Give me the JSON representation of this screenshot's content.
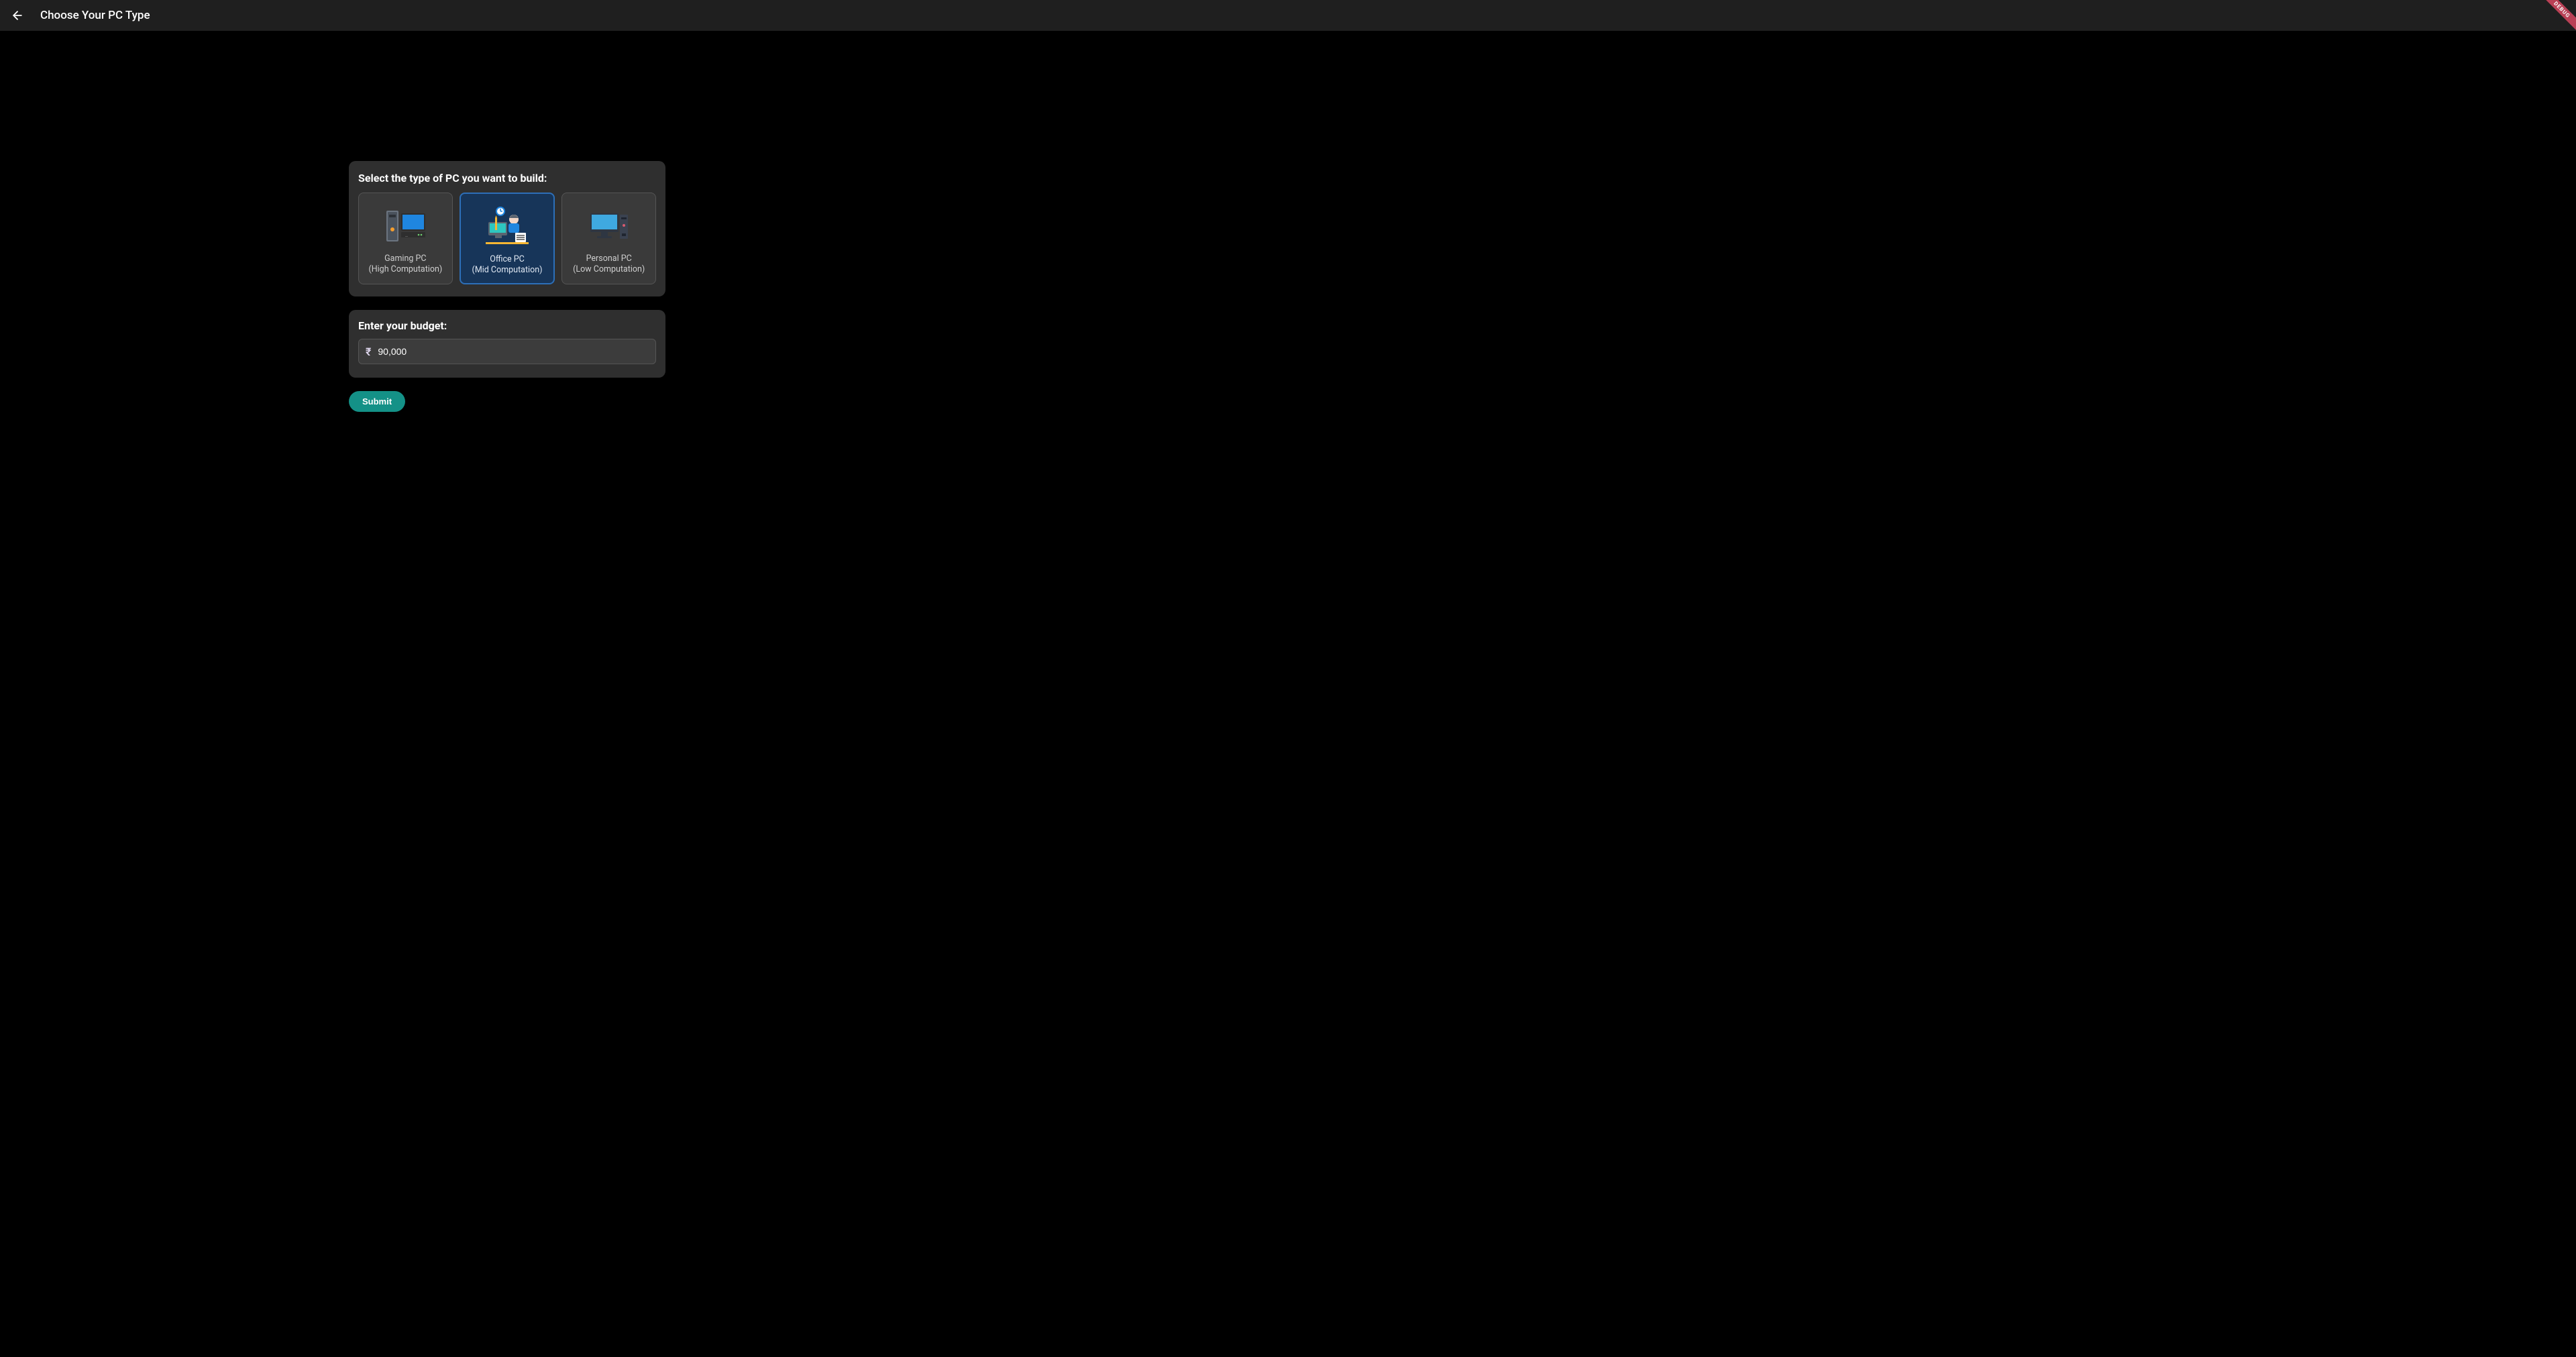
{
  "header": {
    "title": "Choose Your PC Type",
    "debug_label": "DEBUG"
  },
  "type_panel": {
    "heading": "Select the type of PC you want to build:",
    "cards": [
      {
        "title": "Gaming PC",
        "subtitle": "(High Computation)",
        "icon": "gaming-pc-icon",
        "selected": false
      },
      {
        "title": "Office PC",
        "subtitle": "(Mid Computation)",
        "icon": "office-pc-icon",
        "selected": true
      },
      {
        "title": "Personal PC",
        "subtitle": "(Low Computation)",
        "icon": "personal-pc-icon",
        "selected": false
      }
    ]
  },
  "budget_panel": {
    "heading": "Enter your budget:",
    "currency_symbol": "₹",
    "value": "90,000"
  },
  "submit_label": "Submit",
  "colors": {
    "accent": "#149187",
    "selected_bg": "#173559",
    "selected_border": "#2d6fb8",
    "glow": "#8c50dc"
  }
}
